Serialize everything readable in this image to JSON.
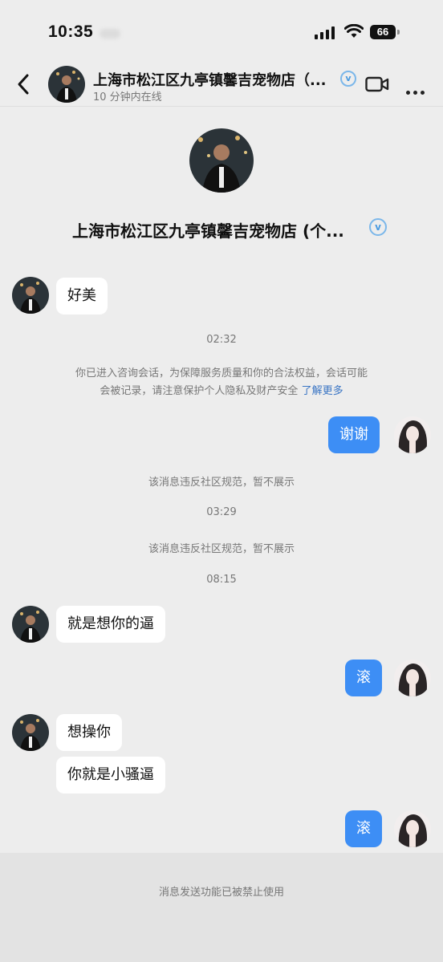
{
  "status_bar": {
    "time": "10:35",
    "battery": "66"
  },
  "header": {
    "name": "上海市松江区九亭镇馨吉宠物店（...",
    "online_status": "10 分钟内在线"
  },
  "profile": {
    "name": "上海市松江区九亭镇馨吉宠物店 (个..."
  },
  "messages": {
    "m1": "好美",
    "time1": "02:32",
    "notice_line1": "你已进入咨询会话，为保障服务质量和你的合法权益，会话可能",
    "notice_line2": "会被记录，请注意保护个人隐私及财产安全",
    "notice_link": "了解更多",
    "m2": "谢谢",
    "blocked1": "该消息违反社区规范，暂不展示",
    "time2": "03:29",
    "blocked2": "该消息违反社区规范，暂不展示",
    "time3": "08:15",
    "m3": "就是想你的逼",
    "m4": "滚",
    "m5": "想操你",
    "m6": "你就是小骚逼",
    "m7": "滚"
  },
  "footer": {
    "disabled_notice": "消息发送功能已被禁止使用"
  },
  "colors": {
    "bubble_out": "#3d8ef5",
    "background": "#ededed",
    "link": "#3a75c4"
  }
}
